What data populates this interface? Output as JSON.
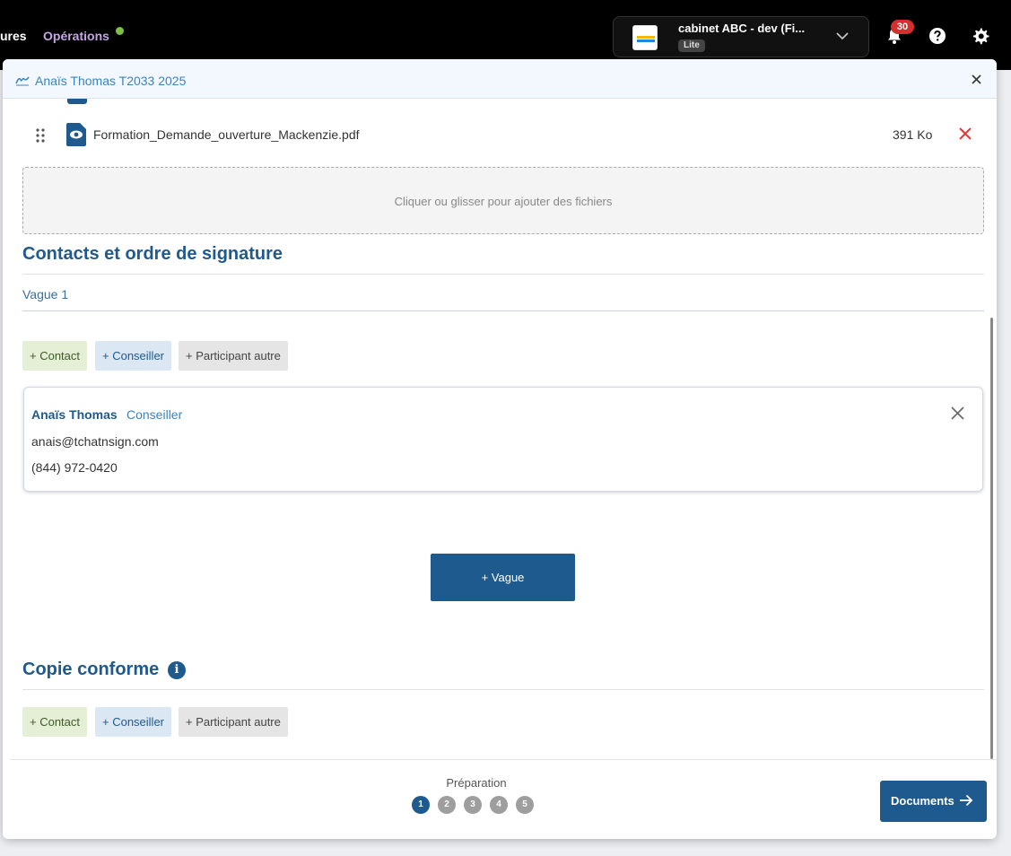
{
  "topbar": {
    "nav_partial": "ures",
    "nav_operations": "Opérations",
    "org_name": "cabinet ABC - dev (Fi...",
    "org_badge": "Lite",
    "notifications_count": "30"
  },
  "modal": {
    "title": "Anaïs Thomas T2033 2025"
  },
  "files": [
    {
      "name": "Formation_Demande_ouverture_Mackenzie.pdf",
      "size": "391 Ko"
    }
  ],
  "dropzone": {
    "text": "Cliquer ou glisser pour ajouter des fichiers"
  },
  "contacts_section": {
    "title": "Contacts et ordre de signature",
    "wave_label": "Vague 1",
    "add_contact": "+ Contact",
    "add_advisor": "+ Conseiller",
    "add_other": "+ Participant autre",
    "participant": {
      "name": "Anaïs Thomas",
      "role": "Conseiller",
      "email": "anais@tchatnsign.com",
      "phone": "(844) 972-0420"
    },
    "add_wave": "+ Vague"
  },
  "copy_section": {
    "title": "Copie conforme",
    "info": "i",
    "add_contact": "+ Contact",
    "add_advisor": "+ Conseiller",
    "add_other": "+ Participant autre"
  },
  "footer": {
    "step_label": "Préparation",
    "steps": [
      "1",
      "2",
      "3",
      "4",
      "5"
    ],
    "active_step": 1,
    "next_button": "Documents"
  },
  "colors": {
    "primary": "#1f5a8e",
    "accent_link": "#3a84c0",
    "danger": "#e53935",
    "contact_chip": "#e4efd6",
    "advisor_chip": "#dbe7f3",
    "other_chip": "#e5e5e5"
  },
  "icons": [
    "signature-icon",
    "close-icon",
    "drag-handle-icon",
    "eye-icon",
    "remove-file-icon",
    "chevron-down-icon",
    "bell-icon",
    "help-icon",
    "gear-icon",
    "info-icon",
    "arrow-right-icon"
  ]
}
